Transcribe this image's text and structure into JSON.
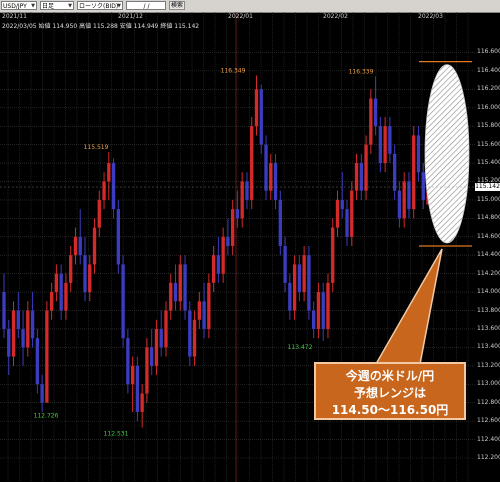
{
  "toolbar": {
    "symbol": "USD/JPY",
    "timeframe": "日足",
    "chart_style": "ローソク(BID)",
    "date_input": "/ /",
    "search_label": "検索"
  },
  "ohlc": {
    "text": "2022/03/05 始値 114.950 高値 115.288 安値 114.949 終値 115.142"
  },
  "current_price": "115.142",
  "callout": {
    "line1": "今週の米ドル/円",
    "line2": "予想レンジは",
    "line3": "114.50〜116.50円"
  },
  "colors": {
    "up": "#d42a2a",
    "down": "#3c3cc0",
    "grid": "#3a3a3a",
    "range_line": "#e07820",
    "callout_bg": "#c7661c"
  },
  "chart_data": {
    "type": "candlestick",
    "ylim": [
      112.2,
      116.8
    ],
    "y_ticks": [
      "116.600",
      "116.400",
      "116.200",
      "116.000",
      "115.800",
      "115.600",
      "115.400",
      "115.200",
      "115.000",
      "114.800",
      "114.600",
      "114.400",
      "114.200",
      "114.000",
      "113.800",
      "113.600",
      "113.400",
      "113.200",
      "113.000",
      "112.800",
      "112.600",
      "112.400",
      "112.200"
    ],
    "x_labels": [
      "2021/11",
      "2021/12",
      "2022/01",
      "2022/02",
      "2022/03"
    ],
    "annotations": [
      {
        "text": "115.519",
        "value": 115.519,
        "kind": "high"
      },
      {
        "text": "116.349",
        "value": 116.349,
        "kind": "high"
      },
      {
        "text": "116.339",
        "value": 116.339,
        "kind": "high"
      },
      {
        "text": "112.726",
        "value": 112.726,
        "kind": "low"
      },
      {
        "text": "112.531",
        "value": 112.531,
        "kind": "low"
      },
      {
        "text": "113.472",
        "value": 113.472,
        "kind": "low"
      }
    ],
    "forecast_range": {
      "low": 114.5,
      "high": 116.5
    },
    "ohlc": [
      [
        114.0,
        114.2,
        113.5,
        113.6
      ],
      [
        113.6,
        113.7,
        113.1,
        113.3
      ],
      [
        113.3,
        113.9,
        113.2,
        113.8
      ],
      [
        113.8,
        114.0,
        113.5,
        113.6
      ],
      [
        113.6,
        113.8,
        113.2,
        113.4
      ],
      [
        113.4,
        113.9,
        113.3,
        113.8
      ],
      [
        113.8,
        114.0,
        113.4,
        113.5
      ],
      [
        113.5,
        113.6,
        112.9,
        113.0
      ],
      [
        113.0,
        113.1,
        112.7,
        112.8
      ],
      [
        112.8,
        113.9,
        112.8,
        113.8
      ],
      [
        113.8,
        114.1,
        113.7,
        114.0
      ],
      [
        114.0,
        114.3,
        113.9,
        114.2
      ],
      [
        114.2,
        114.3,
        113.7,
        113.8
      ],
      [
        113.8,
        114.2,
        113.7,
        114.1
      ],
      [
        114.1,
        114.5,
        114.0,
        114.4
      ],
      [
        114.4,
        114.7,
        114.3,
        114.6
      ],
      [
        114.6,
        114.9,
        114.3,
        114.4
      ],
      [
        114.4,
        114.6,
        113.9,
        114.0
      ],
      [
        114.0,
        114.4,
        113.9,
        114.3
      ],
      [
        114.3,
        114.8,
        114.2,
        114.7
      ],
      [
        114.7,
        115.1,
        114.6,
        115.0
      ],
      [
        115.0,
        115.3,
        114.9,
        115.2
      ],
      [
        115.2,
        115.52,
        115.0,
        115.4
      ],
      [
        115.4,
        115.45,
        114.8,
        114.9
      ],
      [
        114.9,
        115.0,
        114.2,
        114.3
      ],
      [
        114.3,
        114.4,
        113.4,
        113.5
      ],
      [
        113.5,
        113.6,
        112.9,
        113.0
      ],
      [
        113.0,
        113.3,
        112.7,
        113.2
      ],
      [
        113.2,
        113.3,
        112.6,
        112.7
      ],
      [
        112.7,
        113.0,
        112.53,
        112.9
      ],
      [
        112.9,
        113.5,
        112.8,
        113.4
      ],
      [
        113.4,
        113.6,
        113.1,
        113.2
      ],
      [
        113.2,
        113.7,
        113.1,
        113.6
      ],
      [
        113.6,
        113.8,
        113.3,
        113.4
      ],
      [
        113.4,
        113.9,
        113.3,
        113.8
      ],
      [
        113.8,
        114.2,
        113.7,
        114.1
      ],
      [
        114.1,
        114.3,
        113.8,
        113.9
      ],
      [
        113.9,
        114.4,
        113.8,
        114.3
      ],
      [
        114.3,
        114.4,
        113.7,
        113.8
      ],
      [
        113.8,
        113.9,
        113.2,
        113.3
      ],
      [
        113.3,
        113.8,
        113.2,
        113.7
      ],
      [
        113.7,
        114.0,
        113.6,
        113.9
      ],
      [
        113.9,
        114.1,
        113.5,
        113.6
      ],
      [
        113.6,
        114.2,
        113.5,
        114.1
      ],
      [
        114.1,
        114.5,
        114.0,
        114.4
      ],
      [
        114.4,
        114.6,
        114.1,
        114.2
      ],
      [
        114.2,
        114.7,
        114.1,
        114.6
      ],
      [
        114.6,
        114.8,
        114.4,
        114.5
      ],
      [
        114.5,
        115.0,
        114.4,
        114.9
      ],
      [
        114.9,
        115.1,
        114.7,
        114.8
      ],
      [
        114.8,
        115.3,
        114.7,
        115.2
      ],
      [
        115.2,
        115.3,
        114.9,
        115.0
      ],
      [
        115.0,
        115.9,
        114.9,
        115.8
      ],
      [
        115.8,
        116.35,
        115.7,
        116.2
      ],
      [
        116.2,
        116.25,
        115.5,
        115.6
      ],
      [
        115.6,
        115.7,
        115.0,
        115.1
      ],
      [
        115.1,
        115.5,
        115.0,
        115.4
      ],
      [
        115.4,
        115.5,
        114.9,
        115.0
      ],
      [
        115.0,
        115.1,
        114.4,
        114.5
      ],
      [
        114.5,
        114.6,
        114.0,
        114.1
      ],
      [
        114.1,
        114.2,
        113.7,
        113.8
      ],
      [
        113.8,
        114.4,
        113.7,
        114.3
      ],
      [
        114.3,
        114.4,
        113.9,
        114.0
      ],
      [
        114.0,
        114.5,
        113.9,
        114.4
      ],
      [
        114.4,
        114.5,
        113.7,
        113.8
      ],
      [
        113.8,
        113.9,
        113.5,
        113.6
      ],
      [
        113.6,
        114.1,
        113.5,
        114.0
      ],
      [
        114.0,
        114.1,
        113.47,
        113.6
      ],
      [
        113.6,
        114.2,
        113.5,
        114.1
      ],
      [
        114.1,
        114.8,
        114.0,
        114.7
      ],
      [
        114.7,
        115.1,
        114.6,
        115.0
      ],
      [
        115.0,
        115.3,
        114.8,
        114.9
      ],
      [
        114.9,
        115.0,
        114.5,
        114.6
      ],
      [
        114.6,
        115.2,
        114.5,
        115.1
      ],
      [
        115.1,
        115.5,
        115.0,
        115.4
      ],
      [
        115.4,
        115.5,
        115.0,
        115.1
      ],
      [
        115.1,
        115.7,
        115.0,
        115.6
      ],
      [
        115.6,
        116.2,
        115.5,
        116.1
      ],
      [
        116.1,
        116.34,
        115.7,
        115.8
      ],
      [
        115.8,
        115.9,
        115.3,
        115.4
      ],
      [
        115.4,
        115.9,
        115.3,
        115.8
      ],
      [
        115.8,
        115.9,
        115.4,
        115.5
      ],
      [
        115.5,
        115.6,
        115.0,
        115.1
      ],
      [
        115.1,
        115.2,
        114.7,
        114.8
      ],
      [
        114.8,
        115.3,
        114.7,
        115.2
      ],
      [
        115.2,
        115.3,
        114.8,
        114.9
      ],
      [
        114.9,
        115.8,
        114.8,
        115.7
      ],
      [
        115.7,
        115.8,
        115.2,
        115.3
      ],
      [
        115.3,
        115.4,
        114.9,
        115.0
      ],
      [
        114.95,
        115.29,
        114.95,
        115.14
      ]
    ]
  }
}
